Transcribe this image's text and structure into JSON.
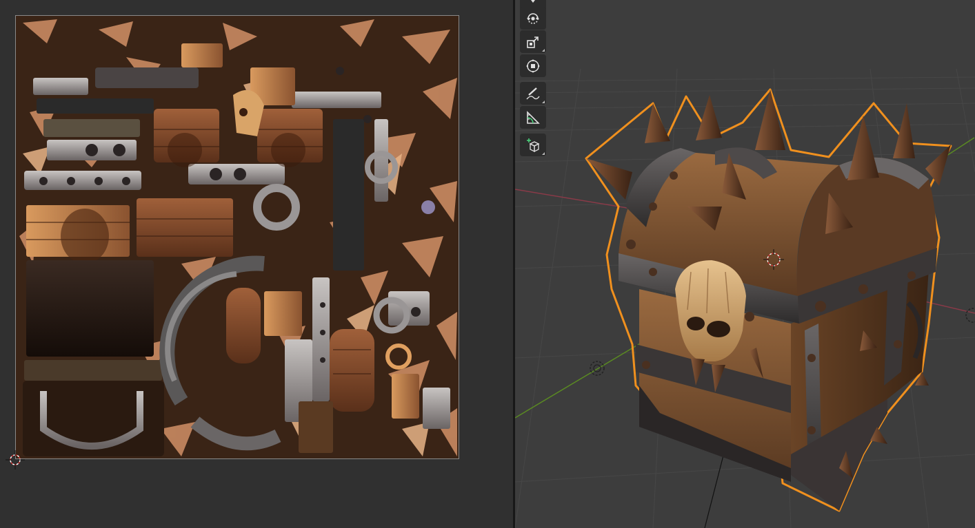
{
  "editors": {
    "left": {
      "type": "image-editor",
      "content": "texture-atlas"
    },
    "right": {
      "type": "3d-viewport",
      "content": "treasure-chest-model",
      "selected": true
    }
  },
  "toolbar": {
    "tools": [
      {
        "name": "move-tool",
        "icon": "move-icon",
        "active": false
      },
      {
        "name": "rotate-tool",
        "icon": "rotate-icon",
        "active": false
      },
      {
        "name": "scale-tool",
        "icon": "scale-icon",
        "active": false
      },
      {
        "name": "transform-tool",
        "icon": "transform-icon",
        "active": false
      },
      {
        "name": "annotate-tool",
        "icon": "annotate-icon",
        "active": false
      },
      {
        "name": "measure-tool",
        "icon": "measure-icon",
        "active": false
      },
      {
        "name": "add-cube-tool",
        "icon": "add-cube-icon",
        "active": false
      }
    ]
  },
  "colors": {
    "editor_bg": "#303030",
    "viewport_bg": "#3d3d3d",
    "toolbar_bg": "#2c2c2c",
    "selection_outline": "#f0901e",
    "axis_x": "#b0404f",
    "axis_y": "#6a9a2a",
    "wood": "#7a4a2a",
    "metal": "#4c4a4a"
  }
}
